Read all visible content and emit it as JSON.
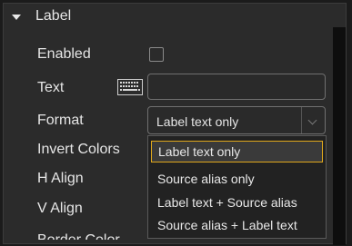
{
  "section": {
    "title": "Label"
  },
  "rows": {
    "enabled": {
      "label": "Enabled",
      "checked": false
    },
    "text": {
      "label": "Text",
      "value": ""
    },
    "format": {
      "label": "Format",
      "value": "Label text only"
    },
    "invert_colors": {
      "label": "Invert Colors"
    },
    "h_align": {
      "label": "H Align"
    },
    "v_align": {
      "label": "V Align"
    },
    "border_color": {
      "label": "Border Color"
    }
  },
  "dropdown": {
    "options": [
      "Label text only",
      "Source alias only",
      "Label text + Source alias",
      "Source alias + Label text"
    ],
    "selected_index": 0
  },
  "colors": {
    "accent": "#e0a81c",
    "background": "#2b2b2b"
  }
}
